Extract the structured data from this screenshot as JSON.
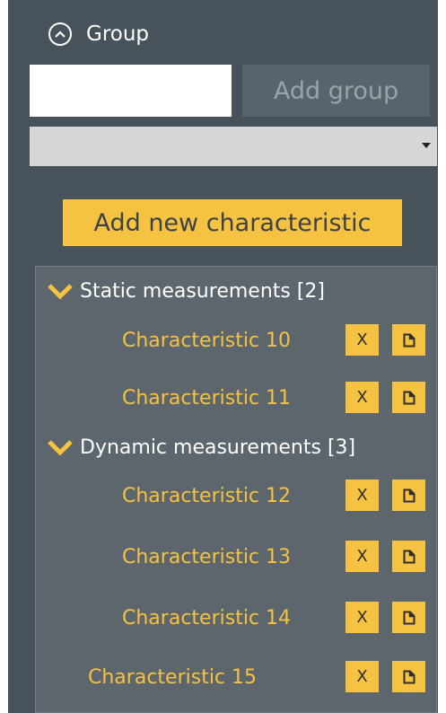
{
  "group": {
    "label": "Group",
    "icon": "chevron-up-circle-icon"
  },
  "new_group": {
    "input_value": "",
    "add_button_label": "Add group"
  },
  "select": {
    "value": ""
  },
  "add_characteristic_label": "Add new characteristic",
  "categories": [
    {
      "label": "Static measurements [2]",
      "items": [
        "Characteristic 10",
        "Characteristic 11"
      ]
    },
    {
      "label": "Dynamic measurements [3]",
      "items": [
        "Characteristic 12",
        "Characteristic 13",
        "Characteristic 14"
      ]
    }
  ],
  "loose_items": [
    "Characteristic 15"
  ],
  "item_actions": {
    "delete_label": "X",
    "copy_icon": "document-icon"
  },
  "colors": {
    "panel": "#47525a",
    "tree": "#5d666d",
    "accent": "#f5c242",
    "text": "#ffffff"
  }
}
